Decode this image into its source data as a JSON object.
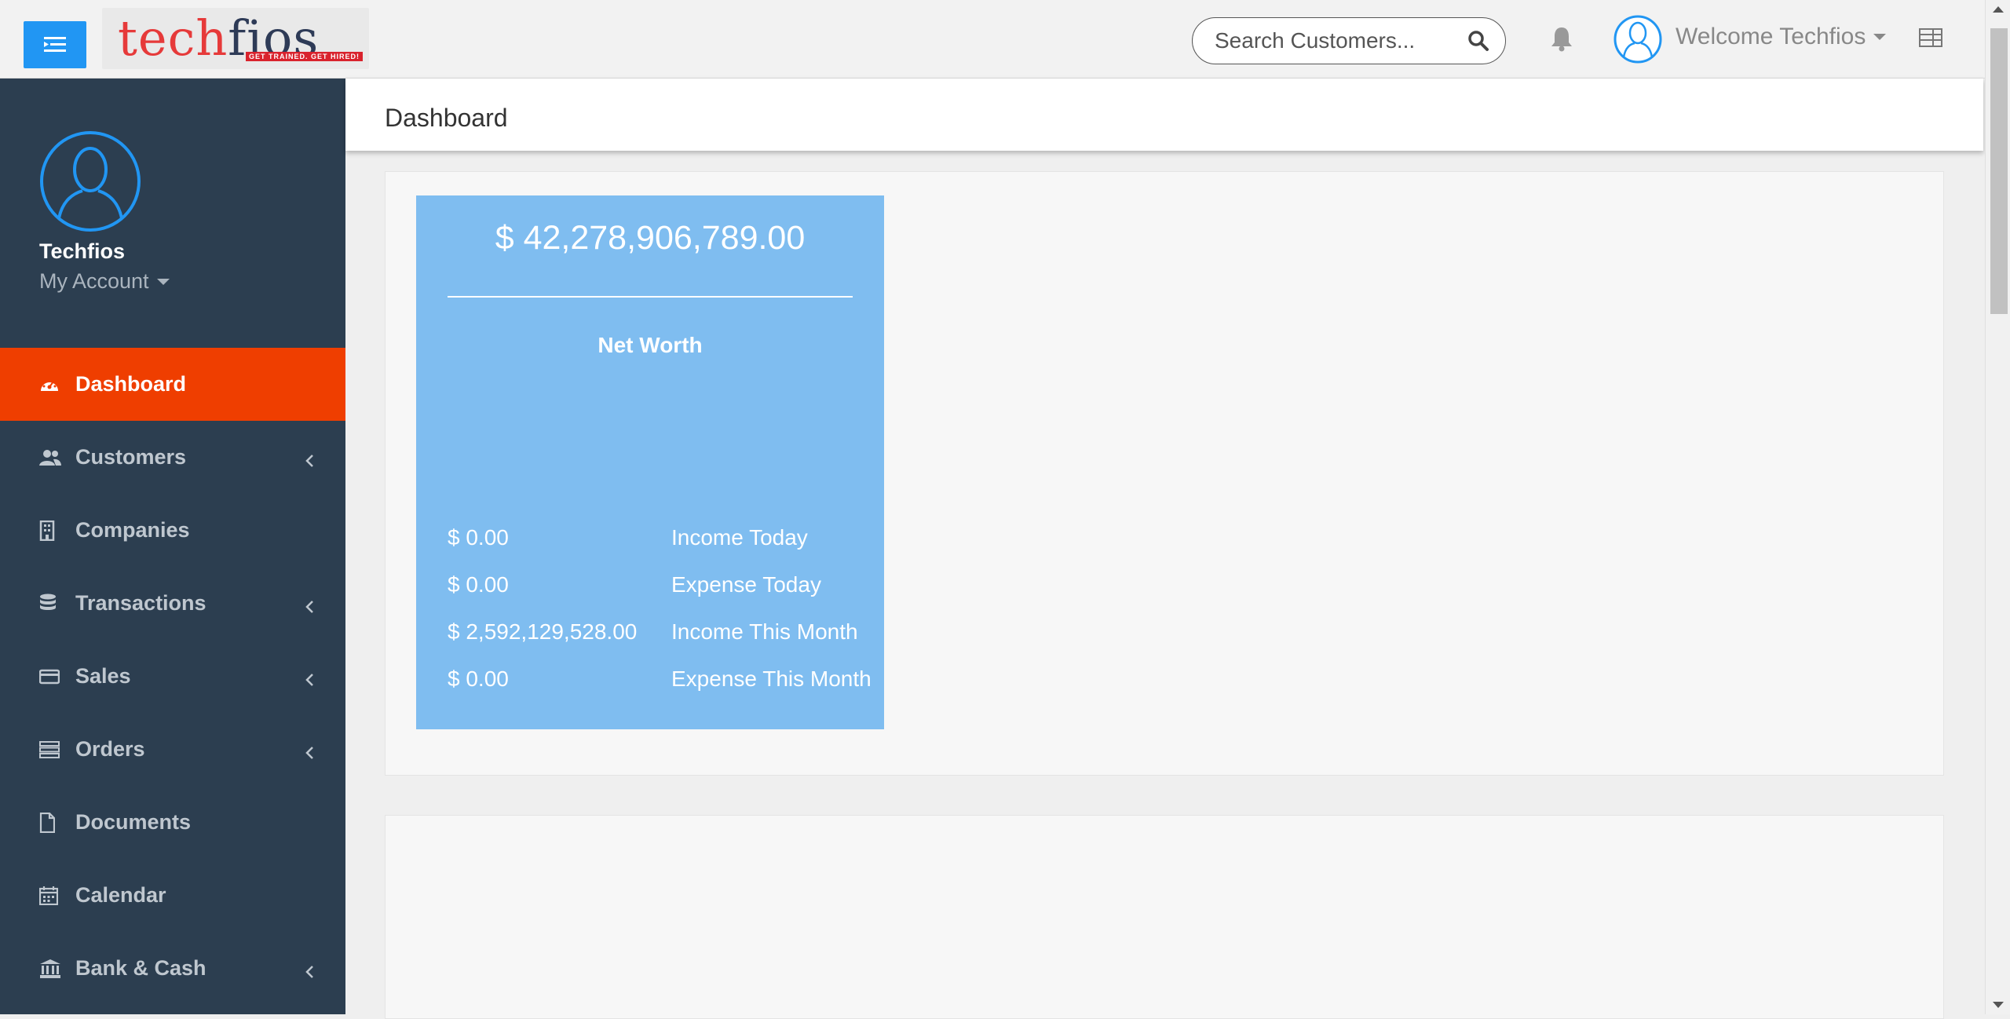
{
  "header": {
    "logo_text_a": "tech",
    "logo_text_b": "fios",
    "logo_tagline": "GET TRAINED. GET HIRED!",
    "search_placeholder": "Search Customers...",
    "welcome": "Welcome Techfios"
  },
  "profile": {
    "name": "Techfios",
    "account_label": "My Account"
  },
  "sidebar": {
    "items": [
      {
        "label": "Dashboard",
        "icon": "dashboard-icon",
        "active": true
      },
      {
        "label": "Customers",
        "icon": "users-icon",
        "expandable": true
      },
      {
        "label": "Companies",
        "icon": "building-icon"
      },
      {
        "label": "Transactions",
        "icon": "database-icon",
        "expandable": true
      },
      {
        "label": "Sales",
        "icon": "credit-card-icon",
        "expandable": true
      },
      {
        "label": "Orders",
        "icon": "server-icon",
        "expandable": true
      },
      {
        "label": "Documents",
        "icon": "file-icon"
      },
      {
        "label": "Calendar",
        "icon": "calendar-icon"
      },
      {
        "label": "Bank & Cash",
        "icon": "bank-icon",
        "expandable": true
      }
    ]
  },
  "page": {
    "title": "Dashboard"
  },
  "networth": {
    "amount": "$ 42,278,906,789.00",
    "label": "Net Worth",
    "rows": [
      {
        "value": "$ 0.00",
        "label": "Income Today"
      },
      {
        "value": "$ 0.00",
        "label": "Expense Today"
      },
      {
        "value": "$ 2,592,129,528.00",
        "label": "Income This Month"
      },
      {
        "value": "$ 0.00",
        "label": "Expense This Month"
      }
    ]
  },
  "colors": {
    "sidebar_bg": "#2c3e50",
    "active_item": "#ef3e00",
    "networth_card": "#7fbdf0",
    "toggle_button": "#2196f3"
  }
}
